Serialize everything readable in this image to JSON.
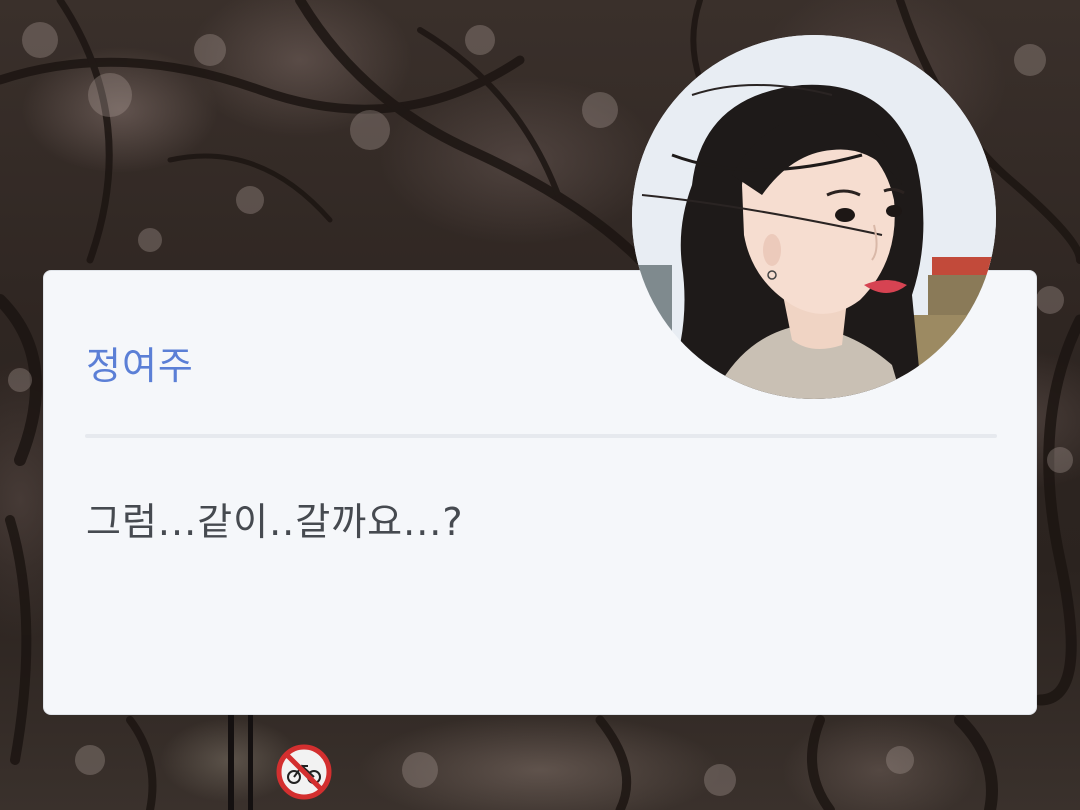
{
  "dialog": {
    "speaker_name": "정여주",
    "message": "그럼...같이..갈까요...?"
  },
  "avatar": {
    "icon": "character-portrait"
  },
  "background": {
    "scene": "cherry-blossom-trees",
    "sign_icon": "no-bicycle-sign"
  },
  "colors": {
    "card_background": "#f5f7fa",
    "speaker_name": "#5b7fd6",
    "message_text": "#464a50",
    "divider": "#e6e9ee"
  }
}
